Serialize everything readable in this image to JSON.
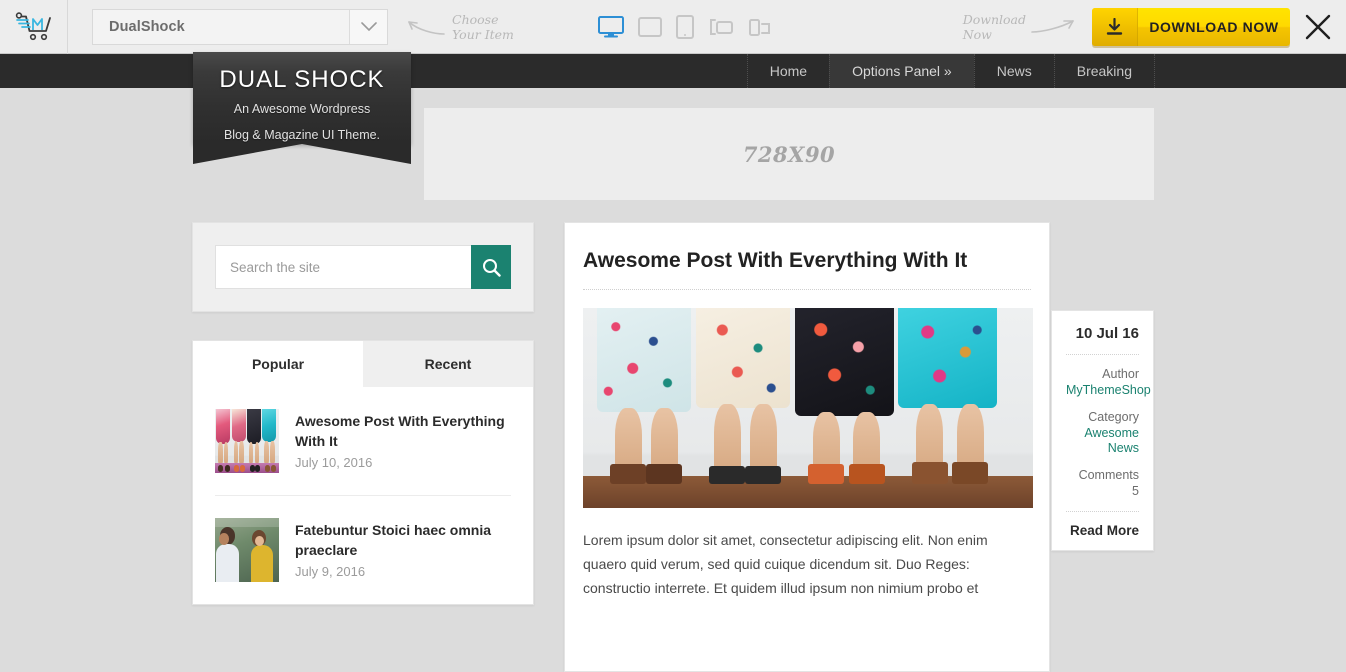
{
  "toolbar": {
    "logo_icon": "shopping-cart-m-logo",
    "theme_select": {
      "value": "DualShock",
      "arrow_icon": "chevron-down-icon"
    },
    "hint_choose": "Choose\nYour Item",
    "hint_choose_line1": "Choose",
    "hint_choose_line2": "Your Item",
    "devices": [
      {
        "name": "desktop",
        "icon": "desktop-icon",
        "active": true
      },
      {
        "name": "tablet-landscape",
        "icon": "tablet-landscape-icon",
        "active": false
      },
      {
        "name": "tablet-portrait",
        "icon": "tablet-portrait-icon",
        "active": false
      },
      {
        "name": "mobile-landscape",
        "icon": "mobile-landscape-icon",
        "active": false
      },
      {
        "name": "mobile-portrait",
        "icon": "mobile-portrait-icon",
        "active": false
      }
    ],
    "hint_download_line1": "Download",
    "hint_download_line2": "Now",
    "download_label": "DOWNLOAD NOW",
    "download_icon": "download-icon",
    "close_icon": "close-icon",
    "accent_active": "#2d8fd5",
    "accent_download": "#ffd900"
  },
  "sitenav": {
    "items": [
      {
        "label": "Home",
        "active": false
      },
      {
        "label": "Options Panel »",
        "active": true
      },
      {
        "label": "News",
        "active": false
      },
      {
        "label": "Breaking",
        "active": false
      }
    ]
  },
  "logo": {
    "title": "DUAL SHOCK",
    "subtitle_line1": "An Awesome Wordpress",
    "subtitle_line2": "Blog & Magazine UI Theme."
  },
  "ad": {
    "label": "728X90"
  },
  "sidebar": {
    "search": {
      "placeholder": "Search the site",
      "value": "",
      "button_icon": "search-icon"
    },
    "tabs": [
      {
        "label": "Popular",
        "active": true
      },
      {
        "label": "Recent",
        "active": false
      }
    ],
    "posts": [
      {
        "title": "Awesome Post With Everything With It",
        "date": "July 10, 2016",
        "thumb": "skirts-photo"
      },
      {
        "title": "Fatebuntur Stoici haec omnia praeclare",
        "date": "July 9, 2016",
        "thumb": "couple-photo"
      }
    ]
  },
  "article": {
    "title": "Awesome Post With Everything With It",
    "image": "four-women-floral-skirts-photo",
    "body": "Lorem ipsum dolor sit amet, consectetur adipiscing elit. Non enim quaero quid verum, sed quid cuique dicendum sit. Duo Reges: constructio interrete. Et quidem illud ipsum non nimium probo et"
  },
  "meta": {
    "date": "10 Jul 16",
    "author_label": "Author",
    "author_value": "MyThemeShop",
    "category_label": "Category",
    "category_value_line1": "Awesome",
    "category_value_line2": "News",
    "comments_label": "Comments",
    "comments_value": "5",
    "read_more": "Read More"
  },
  "colors": {
    "teal": "#1b8270",
    "dark_nav": "#2b2b2b",
    "page_bg": "#dcdcdc"
  }
}
